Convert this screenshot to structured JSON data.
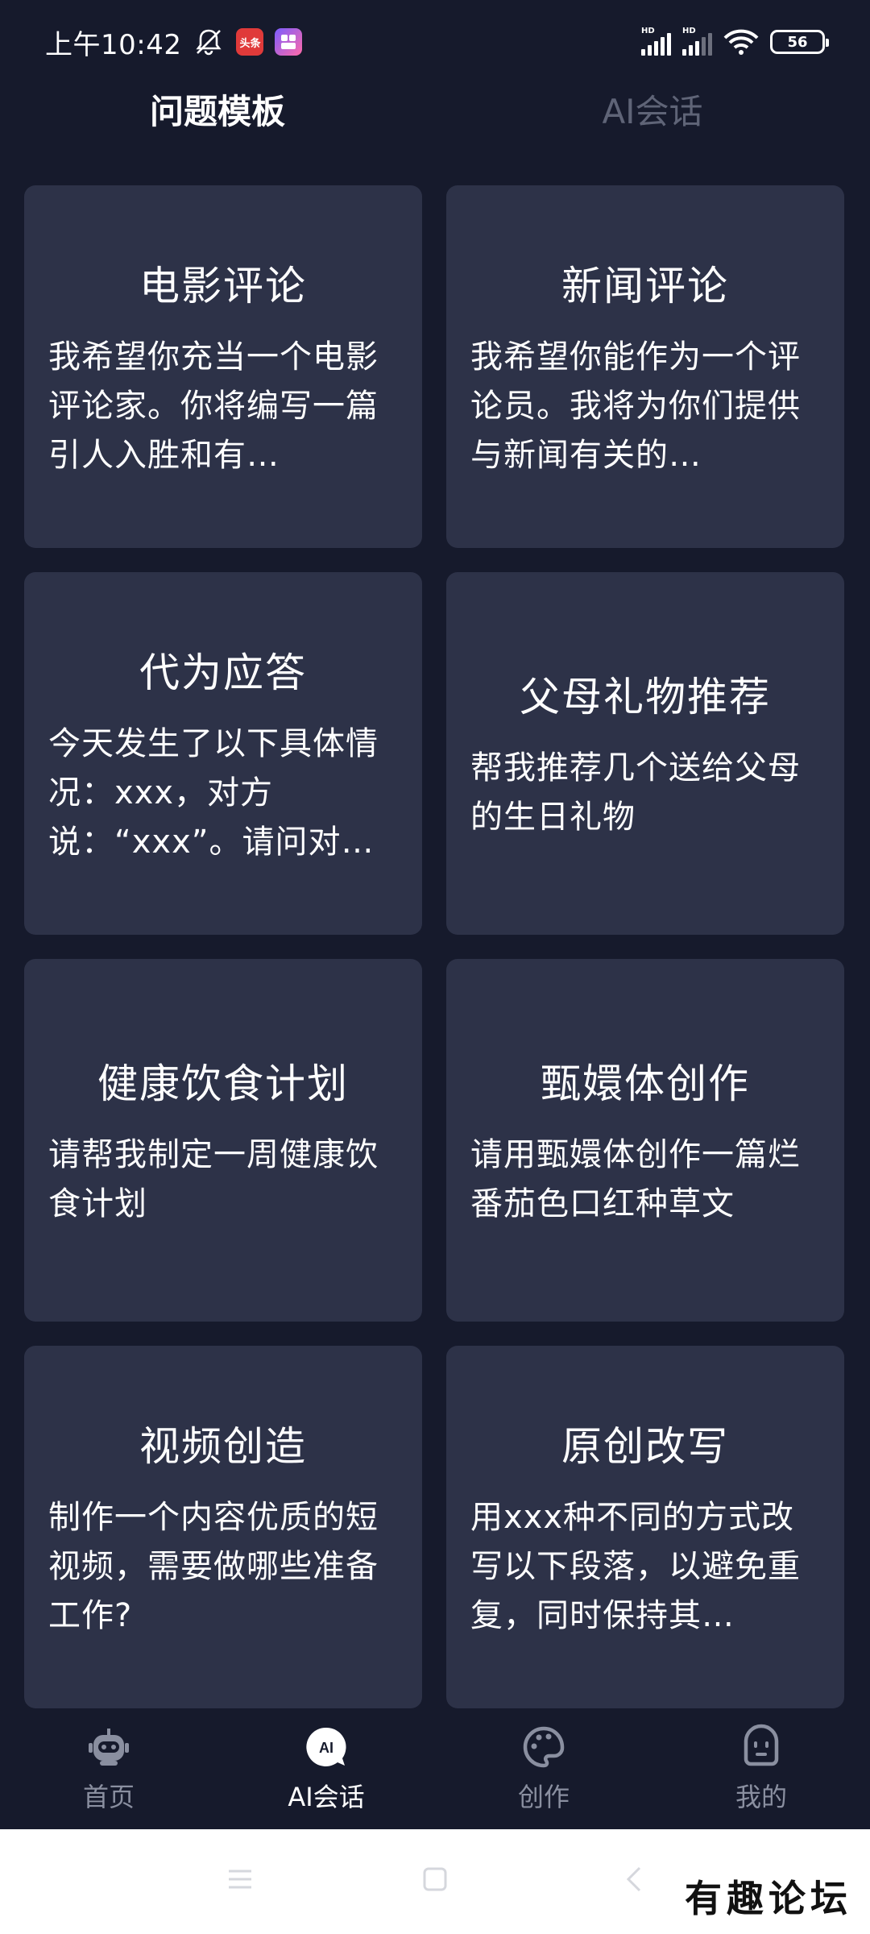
{
  "status_bar": {
    "time": "上午10:42",
    "app_badge_1": "头条",
    "signal_1_label": "HD",
    "signal_2_label": "HD",
    "battery": "56"
  },
  "tabs": [
    {
      "label": "问题模板",
      "active": true
    },
    {
      "label": "AI会话",
      "active": false
    }
  ],
  "cards": [
    {
      "title": "电影评论",
      "desc": "我希望你充当一个电影评论家。你将编写一篇引人入胜和有…"
    },
    {
      "title": "新闻评论",
      "desc": "我希望你能作为一个评论员。我将为你们提供与新闻有关的…"
    },
    {
      "title": "代为应答",
      "desc": "今天发生了以下具体情况：xxx，对方说：“xxx”。请问对方可…"
    },
    {
      "title": "父母礼物推荐",
      "desc": "帮我推荐几个送给父母的生日礼物"
    },
    {
      "title": "健康饮食计划",
      "desc": "请帮我制定一周健康饮食计划"
    },
    {
      "title": "甄嬛体创作",
      "desc": "请用甄嬛体创作一篇烂番茄色口红种草文"
    },
    {
      "title": "视频创造",
      "desc": "制作一个内容优质的短视频，需要做哪些准备工作?"
    },
    {
      "title": "原创改写",
      "desc": "用xxx种不同的方式改写以下段落，以避免重复，同时保持其…"
    }
  ],
  "bottom_nav": [
    {
      "label": "首页",
      "icon": "robot-icon",
      "active": false
    },
    {
      "label": "AI会话",
      "icon": "ai-chat-icon",
      "active": true,
      "icon_text": "AI"
    },
    {
      "label": "创作",
      "icon": "palette-icon",
      "active": false
    },
    {
      "label": "我的",
      "icon": "face-icon",
      "active": false
    }
  ],
  "watermark": "有趣论坛",
  "colors": {
    "background": "#161a2c",
    "card": "#2d3248",
    "inactive_tab": "#5f6477",
    "nav_inactive": "#8a8fa0"
  }
}
